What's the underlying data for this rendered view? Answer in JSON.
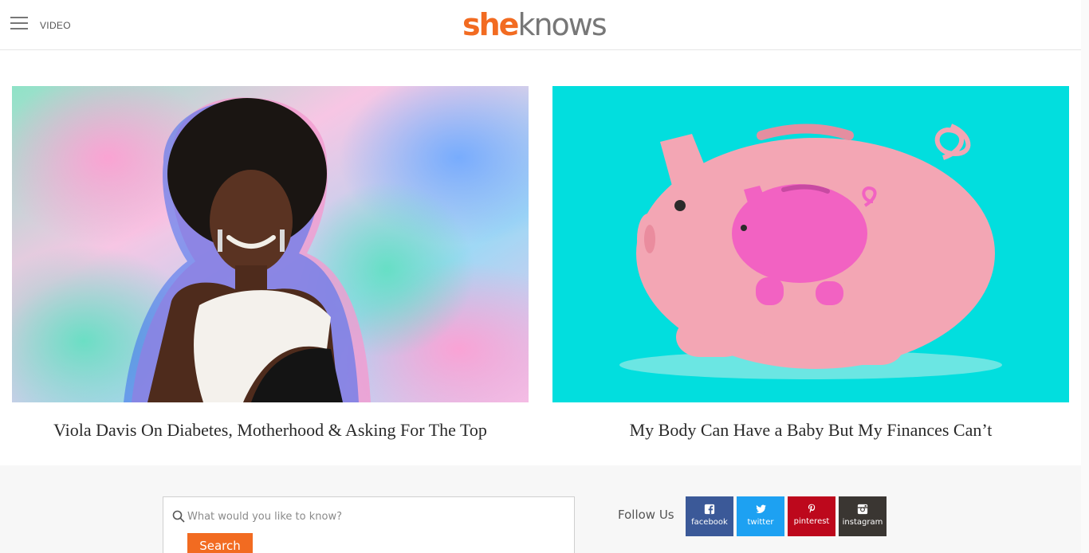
{
  "header": {
    "menu_icon": "hamburger-menu-icon",
    "video_label": "VIDEO",
    "logo_she": "she",
    "logo_knows": "knows",
    "brand_color": "#f26b21"
  },
  "articles": [
    {
      "title": "Viola Davis On Diabetes, Motherhood & Asking For The Top"
    },
    {
      "title": "My Body Can Have a Baby But My Finances Can’t"
    }
  ],
  "search": {
    "placeholder": "What would you like to know?",
    "button_label": "Search"
  },
  "follow": {
    "label": "Follow Us",
    "networks": [
      {
        "label": "facebook",
        "icon": "facebook-icon",
        "color": "#3b5998"
      },
      {
        "label": "twitter",
        "icon": "twitter-icon",
        "color": "#1da1f2"
      },
      {
        "label": "pinterest",
        "icon": "pinterest-icon",
        "color": "#bd081c"
      },
      {
        "label": "instagram",
        "icon": "instagram-icon",
        "color": "#3a3632"
      }
    ]
  }
}
